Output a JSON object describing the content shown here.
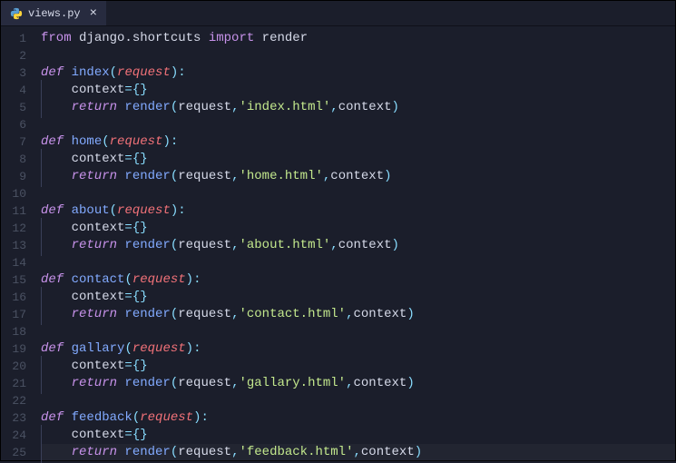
{
  "tab": {
    "filename": "views.py",
    "icon": "python-icon",
    "close_label": "×"
  },
  "lines": {
    "l1_from": "from",
    "l1_mod": "django.shortcuts",
    "l1_import": "import",
    "l1_name": "render",
    "def": "def",
    "ret": "return",
    "context_ident": "context",
    "eq": "=",
    "braces": "{}",
    "render_call": "render",
    "lparen": "(",
    "rparen": ")",
    "colon": ":",
    "comma": ",",
    "request": "request",
    "functions": [
      {
        "name": "index",
        "template": "'index.html'"
      },
      {
        "name": "home",
        "template": "'home.html'"
      },
      {
        "name": "about",
        "template": "'about.html'"
      },
      {
        "name": "contact",
        "template": "'contact.html'"
      },
      {
        "name": "gallary",
        "template": "'gallary.html'"
      },
      {
        "name": "feedback",
        "template": "'feedback.html'"
      }
    ]
  },
  "line_numbers": [
    "1",
    "2",
    "3",
    "4",
    "5",
    "6",
    "7",
    "8",
    "9",
    "10",
    "11",
    "12",
    "13",
    "14",
    "15",
    "16",
    "17",
    "18",
    "19",
    "20",
    "21",
    "22",
    "23",
    "24",
    "25"
  ]
}
